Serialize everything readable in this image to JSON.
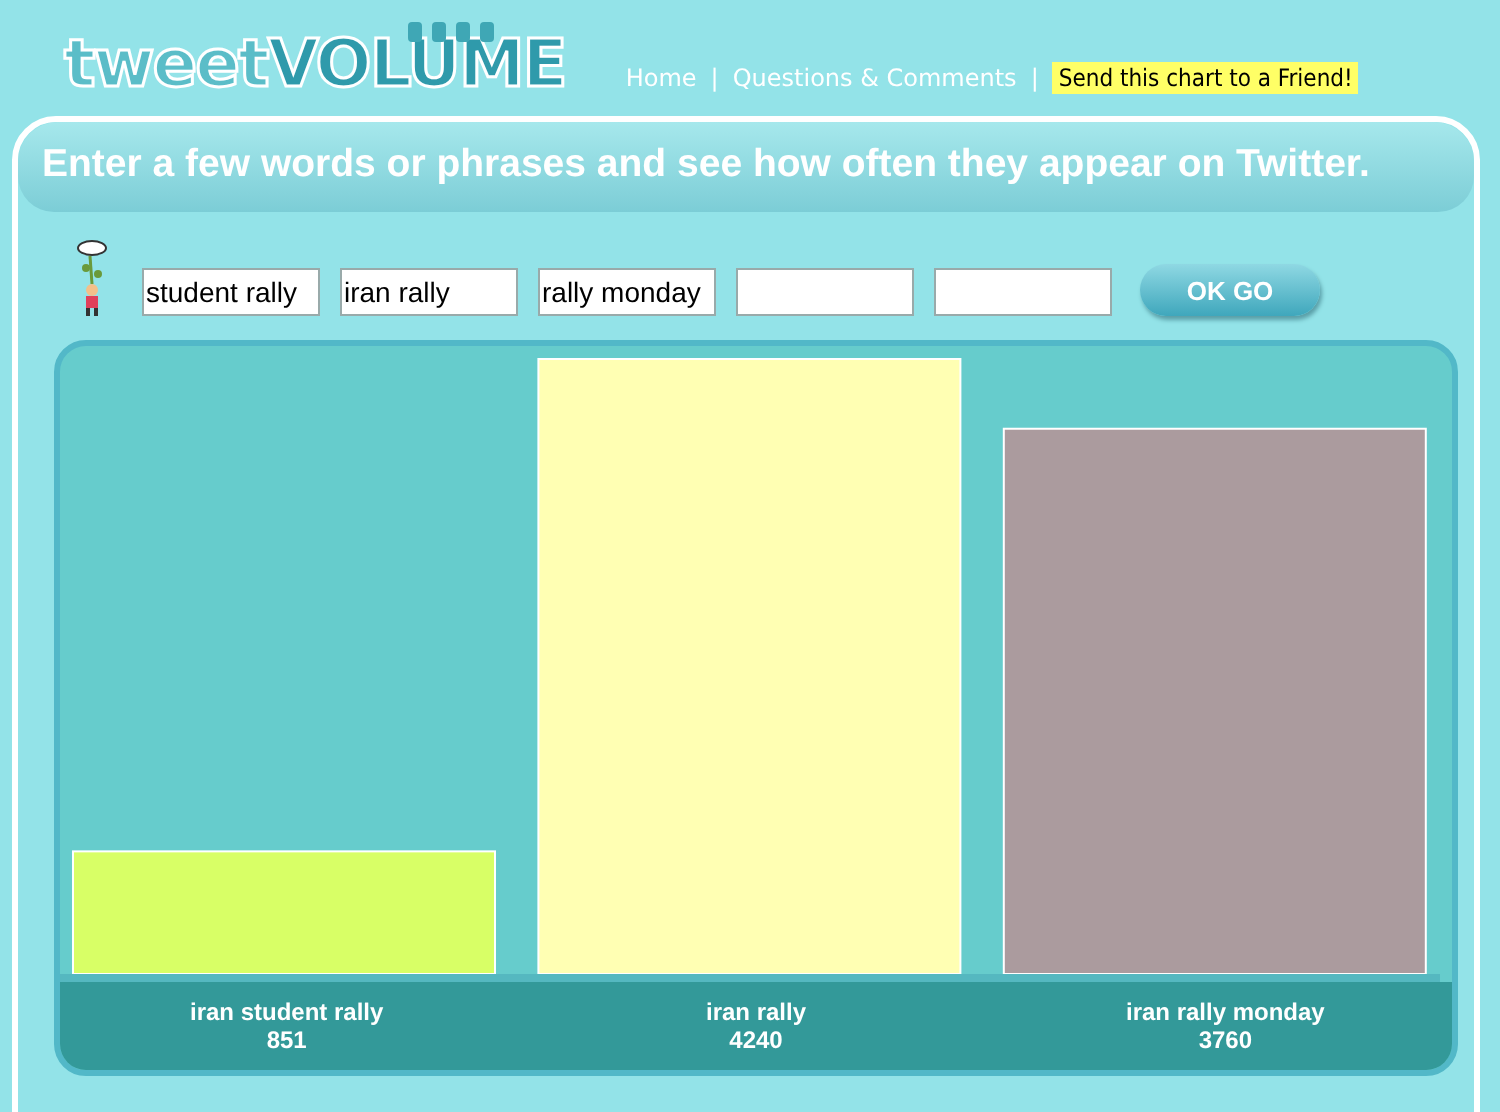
{
  "logo": {
    "part_1": "tweet",
    "part_2": "VOLUME"
  },
  "nav": [
    {
      "label": "Home",
      "kind": "link"
    },
    {
      "label": "|",
      "kind": "sep"
    },
    {
      "label": "Questions & Comments",
      "kind": "link"
    },
    {
      "label": "|",
      "kind": "sep"
    },
    {
      "label": "Send this chart to a Friend!",
      "kind": "highlight"
    }
  ],
  "heading": "Enter a few words or phrases and see how often they appear on Twitter.",
  "inputs": [
    {
      "kind": "filled",
      "value": "student rally"
    },
    {
      "kind": "filled",
      "value": "iran rally"
    },
    {
      "kind": "filled",
      "value": "rally monday"
    },
    {
      "kind": "empty"
    },
    {
      "kind": "empty"
    }
  ],
  "go_button": "OK GO",
  "chart": {
    "chart_data": {
      "type": "bar",
      "categories": [
        "iran student rally",
        "iran rally",
        "iran rally monday"
      ],
      "values": [
        851,
        4240,
        3760
      ],
      "data_labels": true
    },
    "bars": [
      {
        "color": "#d8ff66"
      },
      {
        "color": "#ffffb3"
      },
      {
        "color": "#ab9b9e"
      }
    ]
  }
}
